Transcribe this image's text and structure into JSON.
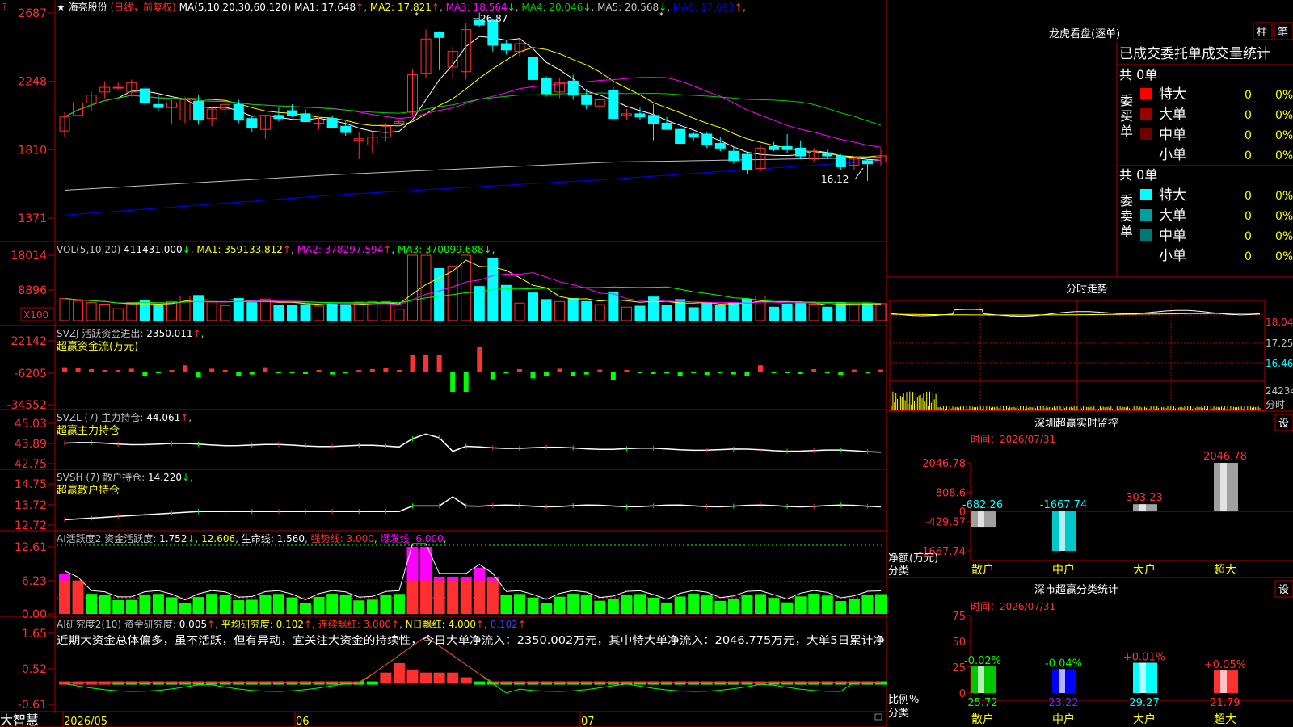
{
  "app": {
    "brand": "大智慧",
    "stock_name": "海亮股份",
    "period": "日线，前复权"
  },
  "colors": {
    "up": "#ff3030",
    "down": "#00ffff",
    "bg": "#000000",
    "grid": "#b00000",
    "ma1": "#ffffff",
    "ma2": "#ffff00",
    "ma3": "#ff00ff",
    "ma4": "#00cc00",
    "ma5": "#c0c0c0",
    "ma6": "#0000ff",
    "green": "#00ff00",
    "yellow": "#ffff00",
    "magenta": "#ff00ff",
    "cyan": "#00ffff"
  },
  "price_panel": {
    "indicator": "MA(5,10,20,30,60,120)",
    "ma_labels": [
      {
        "name": "MA1",
        "value": "17.648",
        "arrow": "↑",
        "color": "#ffffff"
      },
      {
        "name": "MA2",
        "value": "17.821",
        "arrow": "↑",
        "color": "#ffff00"
      },
      {
        "name": "MA3",
        "value": "18.564",
        "arrow": "↓",
        "color": "#ff00ff"
      },
      {
        "name": "MA4",
        "value": "20.046",
        "arrow": "↓",
        "color": "#00cc00"
      },
      {
        "name": "MA5",
        "value": "20.568",
        "arrow": "↓",
        "color": "#c0c0c0"
      },
      {
        "name": "MA6",
        "value": "17.693",
        "arrow": "↑",
        "color": "#0000ff"
      }
    ],
    "y_ticks": [
      "2687",
      "2248",
      "1810",
      "1371"
    ],
    "high_label": "26.87",
    "low_label": "16.12",
    "candles": [
      {
        "o": 19.3,
        "h": 20.5,
        "l": 18.9,
        "c": 20.2
      },
      {
        "o": 20.3,
        "h": 21.3,
        "l": 20.1,
        "c": 21.1
      },
      {
        "o": 21.1,
        "h": 21.8,
        "l": 20.6,
        "c": 21.6
      },
      {
        "o": 21.8,
        "h": 22.5,
        "l": 21.4,
        "c": 22.1
      },
      {
        "o": 22.1,
        "h": 22.4,
        "l": 21.9,
        "c": 22.1
      },
      {
        "o": 21.8,
        "h": 22.6,
        "l": 21.5,
        "c": 22.4
      },
      {
        "o": 22.0,
        "h": 22.2,
        "l": 20.9,
        "c": 21.1
      },
      {
        "o": 21.0,
        "h": 21.6,
        "l": 20.6,
        "c": 20.8
      },
      {
        "o": 20.8,
        "h": 21.3,
        "l": 19.7,
        "c": 21.1
      },
      {
        "o": 20.0,
        "h": 21.5,
        "l": 19.8,
        "c": 21.3
      },
      {
        "o": 21.2,
        "h": 21.6,
        "l": 19.7,
        "c": 20.0
      },
      {
        "o": 20.1,
        "h": 20.8,
        "l": 19.6,
        "c": 20.7
      },
      {
        "o": 20.7,
        "h": 21.1,
        "l": 20.3,
        "c": 21.0
      },
      {
        "o": 21.0,
        "h": 21.3,
        "l": 19.8,
        "c": 20.0
      },
      {
        "o": 20.1,
        "h": 20.3,
        "l": 19.2,
        "c": 19.5
      },
      {
        "o": 19.4,
        "h": 20.3,
        "l": 18.8,
        "c": 20.3
      },
      {
        "o": 20.3,
        "h": 20.8,
        "l": 19.9,
        "c": 20.1
      },
      {
        "o": 20.6,
        "h": 21.0,
        "l": 20.2,
        "c": 20.3
      },
      {
        "o": 20.4,
        "h": 20.7,
        "l": 19.9,
        "c": 19.9
      },
      {
        "o": 19.8,
        "h": 20.2,
        "l": 19.4,
        "c": 20.0
      },
      {
        "o": 20.1,
        "h": 20.3,
        "l": 19.5,
        "c": 19.5
      },
      {
        "o": 19.6,
        "h": 19.9,
        "l": 19.0,
        "c": 19.2
      },
      {
        "o": 18.7,
        "h": 19.2,
        "l": 17.5,
        "c": 18.8
      },
      {
        "o": 18.4,
        "h": 19.3,
        "l": 17.9,
        "c": 18.9
      },
      {
        "o": 18.9,
        "h": 19.8,
        "l": 18.6,
        "c": 19.6
      },
      {
        "o": 19.8,
        "h": 20.0,
        "l": 19.7,
        "c": 19.9
      },
      {
        "o": 20.5,
        "h": 23.3,
        "l": 20.3,
        "c": 22.9
      },
      {
        "o": 23.0,
        "h": 25.8,
        "l": 22.7,
        "c": 25.2
      },
      {
        "o": 25.6,
        "h": 25.7,
        "l": 23.2,
        "c": 25.3
      },
      {
        "o": 23.4,
        "h": 24.7,
        "l": 22.7,
        "c": 24.4
      },
      {
        "o": 23.1,
        "h": 26.2,
        "l": 22.6,
        "c": 25.8
      },
      {
        "o": 26.4,
        "h": 26.9,
        "l": 26.0,
        "c": 26.1
      },
      {
        "o": 26.4,
        "h": 26.5,
        "l": 24.4,
        "c": 24.8
      },
      {
        "o": 24.9,
        "h": 25.1,
        "l": 24.2,
        "c": 24.5
      },
      {
        "o": 24.4,
        "h": 25.2,
        "l": 24.1,
        "c": 24.9
      },
      {
        "o": 24.0,
        "h": 24.2,
        "l": 22.0,
        "c": 22.6
      },
      {
        "o": 22.7,
        "h": 22.8,
        "l": 21.5,
        "c": 21.7
      },
      {
        "o": 21.8,
        "h": 22.7,
        "l": 21.4,
        "c": 22.4
      },
      {
        "o": 22.5,
        "h": 22.9,
        "l": 21.3,
        "c": 21.6
      },
      {
        "o": 21.6,
        "h": 22.0,
        "l": 20.7,
        "c": 21.0
      },
      {
        "o": 20.9,
        "h": 21.5,
        "l": 20.6,
        "c": 21.3
      },
      {
        "o": 21.9,
        "h": 22.1,
        "l": 20.1,
        "c": 20.1
      },
      {
        "o": 20.3,
        "h": 20.7,
        "l": 20.0,
        "c": 20.4
      },
      {
        "o": 20.4,
        "h": 20.8,
        "l": 20.0,
        "c": 20.2
      },
      {
        "o": 20.3,
        "h": 21.0,
        "l": 18.7,
        "c": 19.8
      },
      {
        "o": 19.8,
        "h": 20.2,
        "l": 19.4,
        "c": 19.4
      },
      {
        "o": 19.4,
        "h": 19.9,
        "l": 18.5,
        "c": 18.5
      },
      {
        "o": 19.1,
        "h": 19.2,
        "l": 18.7,
        "c": 18.9
      },
      {
        "o": 19.1,
        "h": 19.2,
        "l": 18.2,
        "c": 18.4
      },
      {
        "o": 18.5,
        "h": 18.9,
        "l": 18.0,
        "c": 18.2
      },
      {
        "o": 18.0,
        "h": 18.3,
        "l": 17.2,
        "c": 17.4
      },
      {
        "o": 17.8,
        "h": 17.9,
        "l": 16.5,
        "c": 16.8
      },
      {
        "o": 16.9,
        "h": 18.4,
        "l": 16.7,
        "c": 18.2
      },
      {
        "o": 18.3,
        "h": 18.6,
        "l": 18.0,
        "c": 18.1
      },
      {
        "o": 18.3,
        "h": 19.1,
        "l": 17.9,
        "c": 18.1
      },
      {
        "o": 18.2,
        "h": 18.7,
        "l": 17.5,
        "c": 17.7
      },
      {
        "o": 17.5,
        "h": 18.2,
        "l": 17.3,
        "c": 18.0
      },
      {
        "o": 17.9,
        "h": 18.1,
        "l": 17.5,
        "c": 17.7
      },
      {
        "o": 17.7,
        "h": 17.8,
        "l": 16.8,
        "c": 17.0
      },
      {
        "o": 17.1,
        "h": 17.6,
        "l": 16.8,
        "c": 17.5
      },
      {
        "o": 17.4,
        "h": 17.5,
        "l": 16.1,
        "c": 17.2
      },
      {
        "o": 17.3,
        "h": 18.2,
        "l": 17.1,
        "c": 17.7
      }
    ]
  },
  "vol_panel": {
    "title": "VOL(5,10,20)",
    "value": "411431.000",
    "arrow": "↓",
    "ma_labels": [
      {
        "name": "MA1",
        "value": "359133.812",
        "arrow": "↑",
        "color": "#ffff00"
      },
      {
        "name": "MA2",
        "value": "378297.594",
        "arrow": "↑",
        "color": "#ff00ff"
      },
      {
        "name": "MA3",
        "value": "370099.688",
        "arrow": "↓",
        "color": "#00ff00"
      }
    ],
    "y_ticks": [
      "18014",
      "8896"
    ],
    "unit": "X100"
  },
  "svzj_panel": {
    "title": "SVZJ",
    "label": "活跃资金进出",
    "value": "2350.011",
    "arrow": "↑",
    "subtitle": "超赢资金流(万元)",
    "y_ticks": [
      "22142",
      "-6205",
      "-34552"
    ]
  },
  "svzl_panel": {
    "title": "SVZL (7)",
    "label": "主力持仓",
    "value": "44.061",
    "arrow": "↑",
    "subtitle": "超赢主力持仓",
    "y_ticks": [
      "45.03",
      "43.89",
      "42.75"
    ]
  },
  "svsh_panel": {
    "title": "SVSH (7)",
    "label": "散户持仓",
    "value": "14.220",
    "arrow": "↓",
    "subtitle": "超赢散户持仓",
    "y_ticks": [
      "14.75",
      "13.72",
      "12.72"
    ]
  },
  "ai_active_panel": {
    "title": "AI活跃度2",
    "label1": "资金活跃度",
    "value1": "1.752",
    "value2": "12.606",
    "label3": "生命线",
    "value3": "1.560",
    "label4": "强势线",
    "value4": "3.000",
    "label5": "爆发线",
    "value5": "6.000",
    "y_ticks": [
      "12.61",
      "6.23",
      "0.00"
    ]
  },
  "ai_research_panel": {
    "title": "AI研究度2(10)",
    "label1": "资金研究度",
    "value1": "0.005",
    "label2": "平均研究度",
    "value2": "0.102",
    "label3": "连续飘红",
    "value3": "3.000",
    "label4": "N日飘红",
    "value4": "4.000",
    "value5": "0.102",
    "comment": "近期大资金总体偏多，虽不活跃，但有异动，宜关注大资金的持续性，今日大单净流入：2350.002万元，其中特大单净流入：2046.775万元，大单5日累计净",
    "y_ticks": [
      "1.65",
      "0.52",
      "-0.61"
    ]
  },
  "x_axis": {
    "labels": [
      "2026/05",
      "06",
      "07"
    ]
  },
  "lhb": {
    "title": "龙虎看盘(逐单)",
    "btn1": "柱",
    "btn2": "笔",
    "subtitle": "已成交委托单成交量统计",
    "buy_label": "委买单",
    "sell_label": "委卖单",
    "total_buy": "共 0单",
    "total_sell": "共 0单",
    "buy_rows": [
      {
        "name": "特大",
        "count": "0",
        "pct": "0%",
        "color": "#ff0000"
      },
      {
        "name": "大单",
        "count": "0",
        "pct": "0%",
        "color": "#9a0000"
      },
      {
        "name": "中单",
        "count": "0",
        "pct": "0%",
        "color": "#6a0000"
      },
      {
        "name": "小单",
        "count": "0",
        "pct": "0%",
        "color": "#000000"
      }
    ],
    "sell_rows": [
      {
        "name": "特大",
        "count": "0",
        "pct": "0%",
        "color": "#00ffff"
      },
      {
        "name": "大单",
        "count": "0",
        "pct": "0%",
        "color": "#00a0a0"
      },
      {
        "name": "中单",
        "count": "0",
        "pct": "0%",
        "color": "#007878"
      },
      {
        "name": "小单",
        "count": "0",
        "pct": "0%",
        "color": "#000000"
      }
    ]
  },
  "intraday": {
    "title": "分时走势",
    "price_ticks": [
      "18.04",
      "17.25",
      "16.46"
    ],
    "vol_tick": "24234",
    "vol_unit": "分时"
  },
  "sz_monitor": {
    "title": "深圳超赢实时监控",
    "btn": "设",
    "date": "时间：2026/07/31",
    "y_ticks": [
      "2046.78",
      "808.6",
      "0",
      "-429.57",
      "-1667.74"
    ],
    "ylabel": "净额(万元)",
    "xlabel": "分类",
    "chart_data": {
      "type": "bar",
      "categories": [
        "散户",
        "中户",
        "大户",
        "超大"
      ],
      "values": [
        -682.26,
        -1667.74,
        303.23,
        2046.78
      ],
      "value_labels": [
        "-682.26",
        "-1667.74",
        "303.23",
        "2046.78"
      ],
      "ylim": [
        -1667.74,
        2046.78
      ],
      "ylabel": "净额(万元)",
      "xlabel": "分类"
    }
  },
  "sz_class": {
    "title": "深市超赢分类统计",
    "btn": "设",
    "date": "时间：2026/07/31",
    "y_ticks": [
      "75",
      "50",
      "25",
      "0"
    ],
    "ylabel": "比例%",
    "xlabel": "分类",
    "chart_data": {
      "type": "bar",
      "categories": [
        "散户",
        "中户",
        "大户",
        "超大"
      ],
      "values": [
        25.72,
        23.22,
        29.27,
        21.79
      ],
      "value_labels": [
        "25.72",
        "23.22",
        "29.27",
        "21.79"
      ],
      "changes": [
        "-0.02%",
        "-0.04%",
        "+0.01%",
        "+0.05%"
      ],
      "ylim": [
        0,
        75
      ],
      "ylabel": "比例%",
      "xlabel": "分类"
    }
  }
}
